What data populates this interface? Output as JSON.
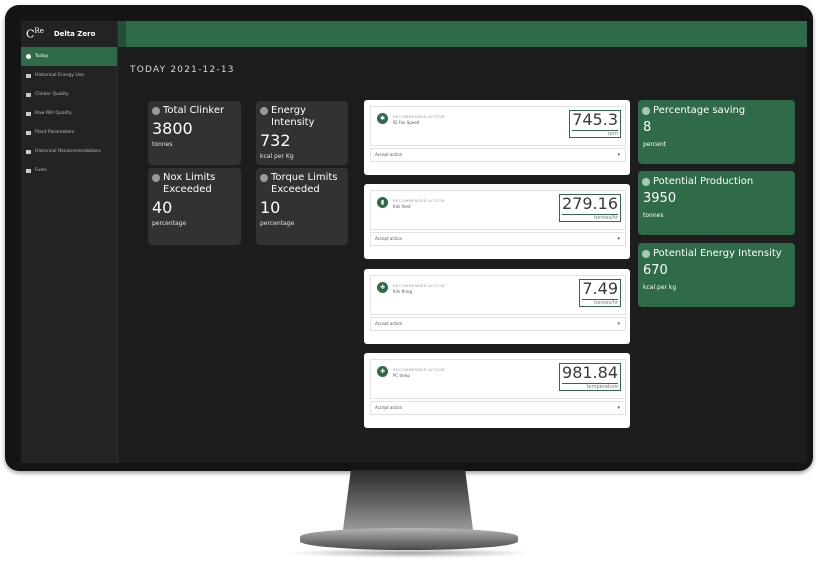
{
  "app": {
    "logo": "C",
    "logo_sup": "Re",
    "name": "Delta Zero"
  },
  "sidebar": {
    "items": [
      {
        "label": "Today",
        "active": true
      },
      {
        "label": "Historical Energy Use"
      },
      {
        "label": "Clinker Quality"
      },
      {
        "label": "Raw Mill Quality"
      },
      {
        "label": "Plant Parameters"
      },
      {
        "label": "Historical Recommendations"
      },
      {
        "label": "Fuels"
      }
    ]
  },
  "main": {
    "date_heading": "TODAY 2021-12-13"
  },
  "kpis": [
    {
      "title": "Total Clinker",
      "value": "3800",
      "unit": "tonnes"
    },
    {
      "title": "Energy Intensity",
      "value": "732",
      "unit": "kcal per Kg"
    },
    {
      "title": "Nox Limits Exceeded",
      "value": "40",
      "unit": "percentage"
    },
    {
      "title": "Torque Limits Exceeded",
      "value": "10",
      "unit": "percentage"
    }
  ],
  "recommendations": [
    {
      "label": "RECOMMENDED ACTION",
      "param": "ID Fan Speed",
      "value": "745.3",
      "unit": "rpm",
      "select": "Accept action"
    },
    {
      "label": "RECOMMENDED ACTION",
      "param": "Kiln feed",
      "value": "279.16",
      "unit": "tonnes/hr",
      "select": "Accept action"
    },
    {
      "label": "RECOMMENDED ACTION",
      "param": "Kiln firing",
      "value": "7.49",
      "unit": "tonnes/hr",
      "select": "Accept action"
    },
    {
      "label": "RECOMMENDED ACTION",
      "param": "PC temp",
      "value": "981.84",
      "unit": "temperature",
      "select": "Accept action"
    }
  ],
  "savings": [
    {
      "title": "Percentage saving",
      "value": "8",
      "unit": "percent"
    },
    {
      "title": "Potential Production",
      "value": "3950",
      "unit": "tonnes"
    },
    {
      "title": "Potential Energy Intensity",
      "value": "670",
      "unit": "kcal per kg"
    }
  ],
  "colors": {
    "accent": "#2f6b49",
    "tile": "#323232",
    "background": "#1d1d1d"
  }
}
